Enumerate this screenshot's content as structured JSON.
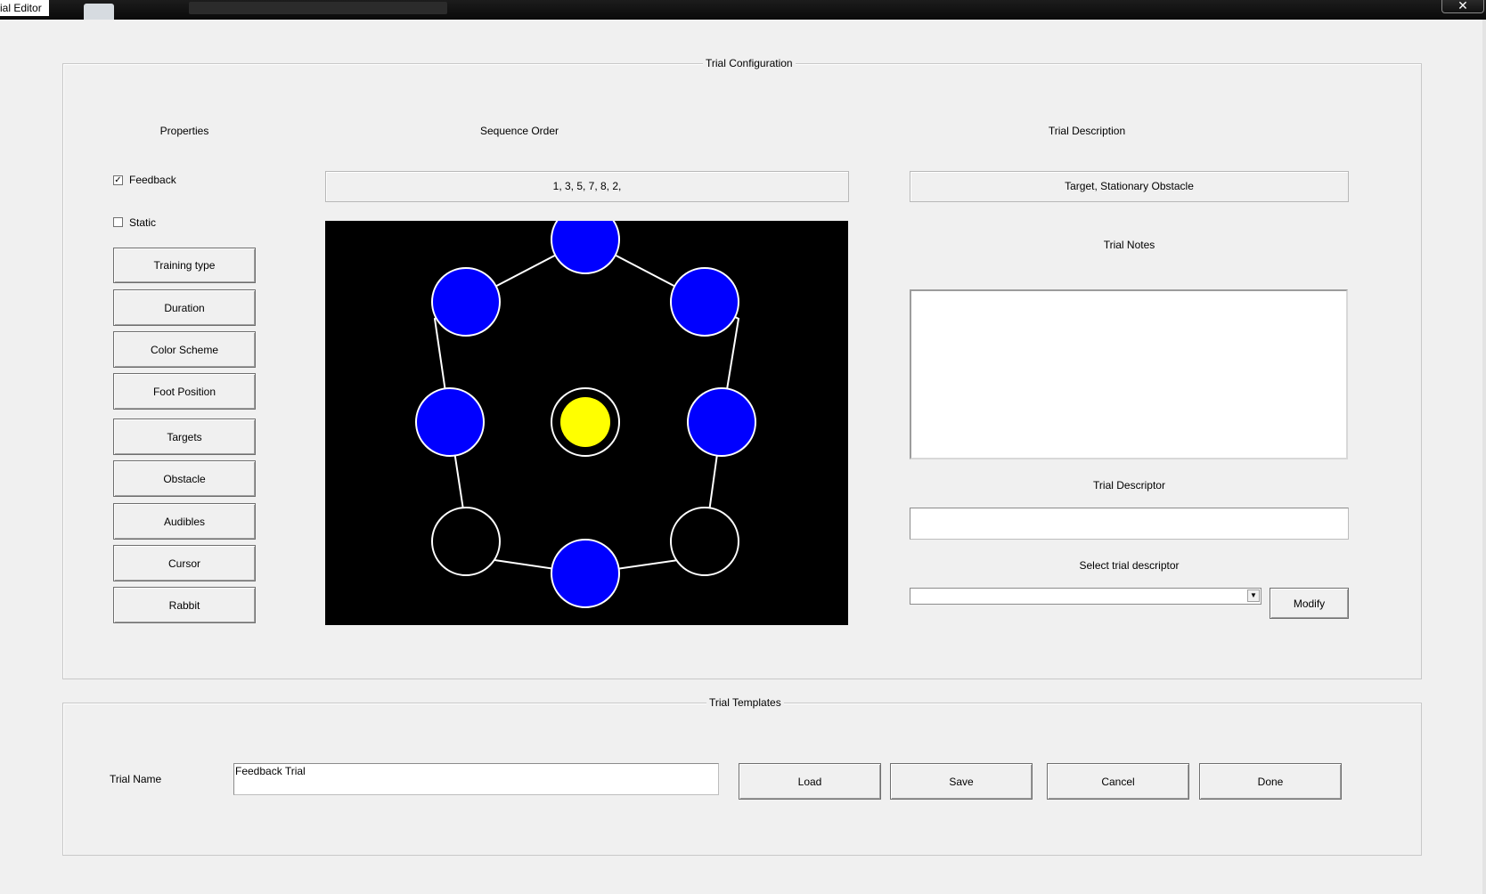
{
  "window": {
    "title": "ial Editor",
    "close_glyph": "✕"
  },
  "config_group": {
    "legend": "Trial Configuration"
  },
  "properties": {
    "heading": "Properties",
    "feedback": {
      "label": "Feedback",
      "checked": true,
      "check_glyph": "✓"
    },
    "static": {
      "label": "Static",
      "checked": false
    },
    "buttons": [
      "Training type",
      "Duration",
      "Color Scheme",
      "Foot Position",
      "Targets",
      "Obstacle",
      "Audibles",
      "Cursor",
      "Rabbit"
    ]
  },
  "sequence": {
    "heading": "Sequence Order",
    "value": "1, 3, 5, 7, 8, 2,"
  },
  "preview": {
    "background": "#000000",
    "target_color": "#0000ff",
    "center_color": "#ffff00",
    "outline_color": "#ffffff",
    "targets": [
      {
        "n": 1,
        "filled": true
      },
      {
        "n": 2,
        "filled": true
      },
      {
        "n": 3,
        "filled": true
      },
      {
        "n": 4,
        "filled": true
      },
      {
        "n": 5,
        "filled": false
      },
      {
        "n": 6,
        "filled": true
      },
      {
        "n": 7,
        "filled": false
      },
      {
        "n": 8,
        "filled": true
      }
    ]
  },
  "description": {
    "heading": "Trial Description",
    "value": "Target, Stationary Obstacle"
  },
  "notes": {
    "heading": "Trial Notes",
    "value": ""
  },
  "descriptor": {
    "heading": "Trial Descriptor",
    "value": "",
    "select_heading": "Select trial descriptor",
    "selected": "",
    "arrow_glyph": "▼",
    "modify_label": "Modify"
  },
  "templates_group": {
    "legend": "Trial Templates",
    "name_label": "Trial Name",
    "name_value": "Feedback Trial",
    "buttons": {
      "load": "Load",
      "save": "Save",
      "cancel": "Cancel",
      "done": "Done"
    }
  }
}
